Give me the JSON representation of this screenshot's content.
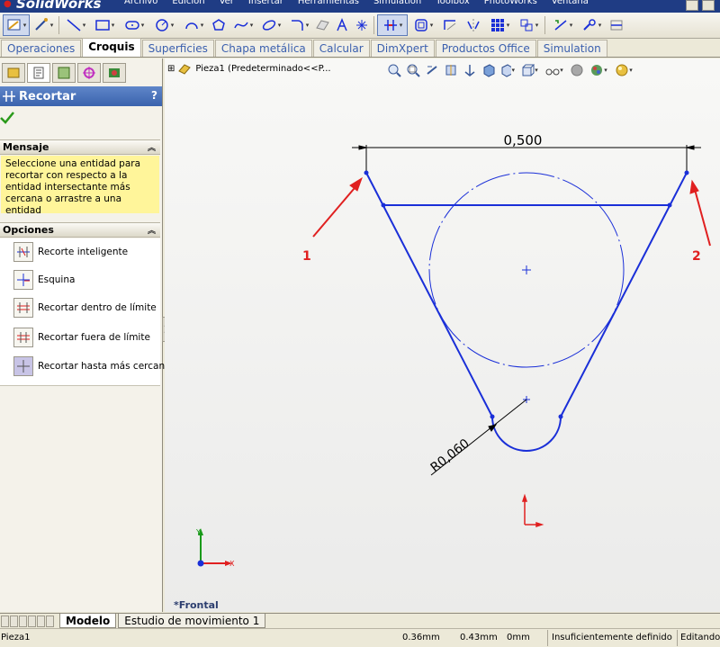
{
  "app": {
    "logo": "SolidWorks",
    "menus": [
      "Archivo",
      "Edición",
      "Ver",
      "Insertar",
      "Herramientas",
      "Simulation",
      "Toolbox",
      "PhotoWorks",
      "Ventana"
    ]
  },
  "command_tabs": [
    {
      "label": "Operaciones",
      "selected": false
    },
    {
      "label": "Croquis",
      "selected": true
    },
    {
      "label": "Superficies",
      "selected": false
    },
    {
      "label": "Chapa metálica",
      "selected": false
    },
    {
      "label": "Calcular",
      "selected": false
    },
    {
      "label": "DimXpert",
      "selected": false
    },
    {
      "label": "Productos Office",
      "selected": false
    },
    {
      "label": "Simulation",
      "selected": false
    }
  ],
  "property_manager": {
    "title": "Recortar",
    "help": "?",
    "message_header": "Mensaje",
    "message": "Seleccione una entidad para recortar con respecto a la entidad intersectante más cercana o arrastre a una entidad",
    "options_header": "Opciones",
    "options": [
      {
        "label": "Recorte inteligente",
        "icon": "smart-trim-icon"
      },
      {
        "label": "Esquina",
        "icon": "corner-trim-icon"
      },
      {
        "label": "Recortar dentro de límite",
        "icon": "trim-inside-icon"
      },
      {
        "label": "Recortar fuera de límite",
        "icon": "trim-outside-icon"
      },
      {
        "label": "Recortar hasta más cercano",
        "icon": "trim-closest-icon"
      }
    ]
  },
  "graphics": {
    "tree_node": "Pieza1  (Predeterminado<<P...",
    "view_name": "*Frontal",
    "dimension_top": "0,500",
    "dimension_radius": "R0,060",
    "callout_1": "1",
    "callout_2": "2",
    "triad_x": "X",
    "triad_y": "Y",
    "colors": {
      "sketch": "#1a2fd8",
      "callout": "#e02020",
      "dimension": "#000000"
    }
  },
  "bottom_tabs": [
    {
      "label": "Modelo",
      "selected": true
    },
    {
      "label": "Estudio de movimiento 1",
      "selected": false
    }
  ],
  "status": {
    "doc": "Pieza1",
    "x": "0.36mm",
    "y": "0.43mm",
    "z": "0mm",
    "state": "Insuficientemente definido",
    "mode": "Editando"
  }
}
